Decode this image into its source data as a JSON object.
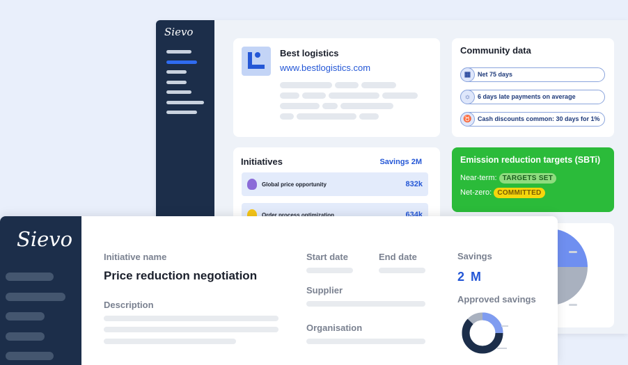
{
  "back_window": {
    "logo": "Sievo",
    "supplier": {
      "name": "Best logistics",
      "url": "www.bestlogistics.com"
    },
    "community": {
      "title": "Community data",
      "items": [
        {
          "icon": "calendar-icon",
          "label": "Net 75 days"
        },
        {
          "icon": "lightbulb-icon",
          "label": "6 days late payments on average"
        },
        {
          "icon": "piggy-bank-icon",
          "label": "Cash discounts common: 30 days for 1%"
        }
      ]
    },
    "initiatives": {
      "title": "Initiatives",
      "savings": "Savings 2M",
      "rows": [
        {
          "name": "Global price opportunity",
          "value": "832k"
        },
        {
          "name": "Order process optimization",
          "value": "634k"
        }
      ]
    },
    "sbti": {
      "title": "Emission reduction targets (SBTi)",
      "near_term_label": "Near-term:",
      "near_term_badge": "TARGETS SET",
      "net_zero_label": "Net-zero:",
      "net_zero_badge": "COMMITTED"
    }
  },
  "front_window": {
    "logo": "Sievo",
    "initiative_name_label": "Initiative name",
    "initiative_name": "Price reduction negotiation",
    "description_label": "Description",
    "start_date_label": "Start date",
    "end_date_label": "End date",
    "supplier_label": "Supplier",
    "organisation_label": "Organisation",
    "savings_label": "Savings",
    "savings_value": "2 M",
    "approved_savings_label": "Approved savings",
    "approved_fraction": 0.62
  },
  "colors": {
    "navy": "#1c2e4a",
    "accent_blue": "#2457d6",
    "green": "#2bbb3a",
    "yellow": "#f5d60c"
  }
}
